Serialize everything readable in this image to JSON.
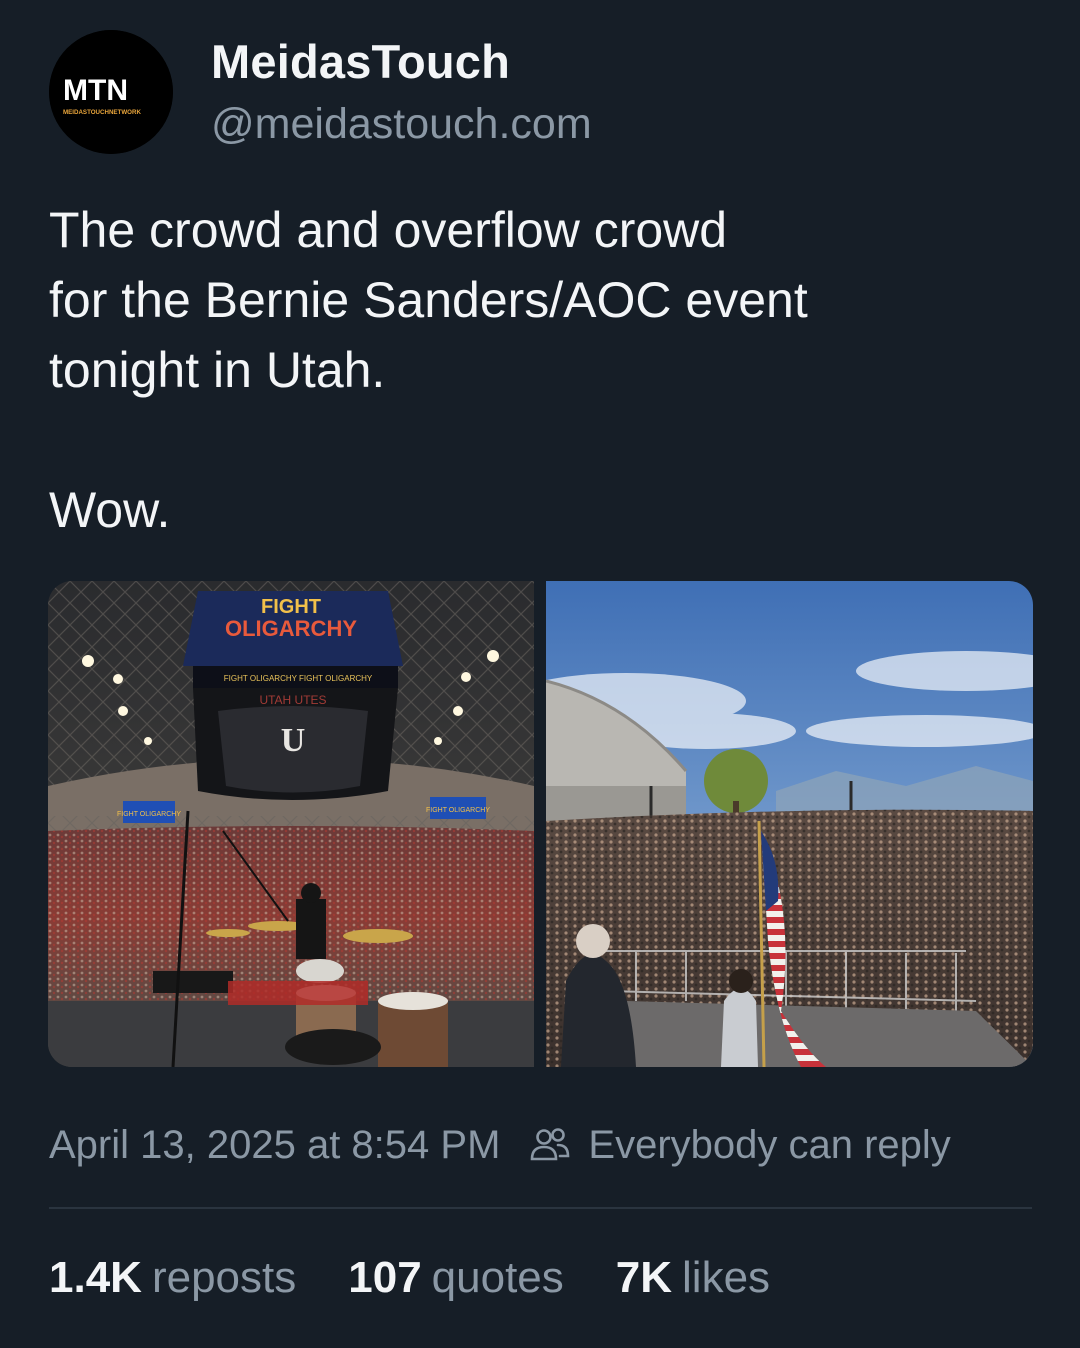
{
  "author": {
    "display_name": "MeidasTouch",
    "handle": "@meidastouch.com",
    "avatar": {
      "icon": "mtn-logo",
      "brand_text": "MTN",
      "sub_text": "MEIDASTOUCHNETWORK",
      "accent_color": "#e9a53b"
    }
  },
  "post": {
    "text_lines": [
      "The crowd and overflow crowd",
      "for the Bernie Sanders/AOC event",
      "tonight in Utah."
    ],
    "text_final": "Wow."
  },
  "media": {
    "left_photo": {
      "scoreboard_line1": "FIGHT",
      "scoreboard_line2": "OLIGARCHY",
      "ribbon_text": "UTAH UTES",
      "fascia_text": "FIGHT OLIGARCHY   FIGHT OLIGARCHY",
      "side_sign_left": "FIGHT OLIGARCHY",
      "side_sign_right": "FIGHT OLIGARCHY"
    },
    "right_photo": {
      "flag": "american-flag"
    }
  },
  "meta": {
    "timestamp": "April 13, 2025 at 8:54 PM",
    "reply_setting": "Everybody can reply",
    "reply_icon": "people-icon"
  },
  "stats": {
    "reposts_count": "1.4K",
    "reposts_label": "reposts",
    "quotes_count": "107",
    "quotes_label": "quotes",
    "likes_count": "7K",
    "likes_label": "likes"
  },
  "colors": {
    "background": "#161e27",
    "primary_text": "#f3f5f7",
    "secondary_text": "#8b98a5",
    "divider": "#2a343f"
  }
}
